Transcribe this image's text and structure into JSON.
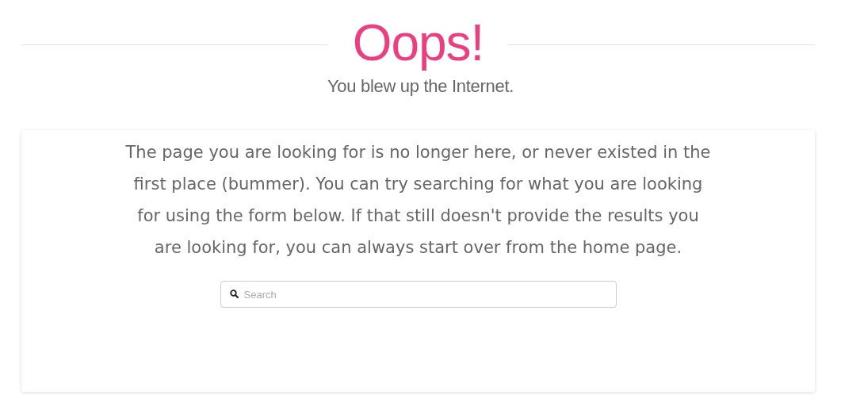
{
  "heading": "Oops!",
  "subtitle": "You blew up the Internet.",
  "message": "The page you are looking for is no longer here, or never existed in the first place (bummer). You can try searching for what you are looking for using the form below. If that still doesn't provide the results you are looking for, you can always start over from the home page.",
  "search": {
    "placeholder": "Search"
  }
}
